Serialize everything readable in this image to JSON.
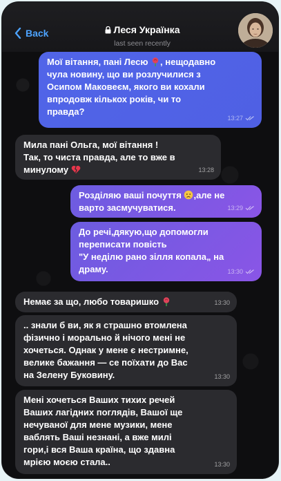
{
  "header": {
    "back_label": "Back",
    "contact_name": "Леся Українка",
    "status": "last seen recently"
  },
  "messages": [
    {
      "direction": "outgoing",
      "color": "#5165e8",
      "lines": [
        "Мої вітання, пані Лесю",
        ", нещодавно",
        "чула новину, що ви розлучилися з",
        "Осипом Маковеєм, якого ви кохали",
        "впродовж кількох років, чи то",
        "правда?"
      ],
      "emojis": [
        "rose"
      ],
      "time": "13:27",
      "read": true
    },
    {
      "direction": "incoming",
      "color": "#2b2b2f",
      "lines": [
        "Мила пані Ольга, мої вітання !",
        "Так, то чиста правда, але то вже в",
        "минулому"
      ],
      "emojis": [
        "broken-heart"
      ],
      "time": "13:28"
    },
    {
      "direction": "outgoing",
      "color": "#6c5ce0",
      "lines": [
        "Розділяю ваші почуття",
        ",але не",
        "варто засмучуватися."
      ],
      "emojis": [
        "sad-face"
      ],
      "time": "13:29",
      "read": true
    },
    {
      "direction": "outgoing",
      "color": "#7a57e3",
      "lines": [
        "До речі,дякую,що допомогли",
        "переписати повість",
        "\"У неділю рано зілля копала„ на",
        "драму."
      ],
      "time": "13:30",
      "read": true
    },
    {
      "direction": "incoming",
      "color": "#2b2b2f",
      "lines": [
        "Немає за що, любо товаришко"
      ],
      "emojis": [
        "rose"
      ],
      "time": "13:30"
    },
    {
      "direction": "incoming",
      "color": "#2b2b2f",
      "lines": [
        ".. знали б ви, як я страшно втомлена",
        "фізично і морально й нічого мені не",
        "хочеться. Однак у мене є нестримне,",
        "велике бажання — се поїхати до Вас",
        "на Зелену Буковину."
      ],
      "time": "13:30"
    },
    {
      "direction": "incoming",
      "color": "#2b2b2f",
      "lines": [
        "Мені хочеться Ваших тихих речей",
        "Ваших лагідних поглядів, Вашої ще",
        "нечуваної для мене музики, мене",
        "ваблять Ваші незнані, а вже милі",
        "гори,і вся Ваша країна, що здавна",
        "мрією моєю стала.."
      ],
      "time": "13:30"
    }
  ]
}
